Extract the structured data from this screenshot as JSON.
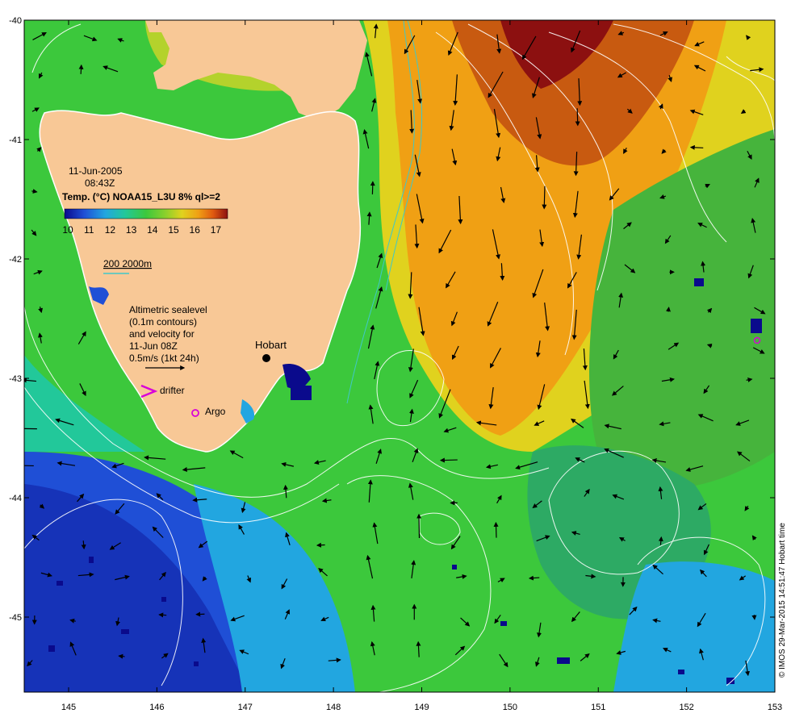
{
  "map": {
    "date": "11-Jun-2005",
    "time": "08:43Z",
    "product": "Temp. (°C) NOAA15_L3U 8% ql>=2",
    "colorbar_ticks": [
      "10",
      "11",
      "12",
      "13",
      "14",
      "15",
      "16",
      "17"
    ],
    "colorbar_colors": [
      "#0a0a8c",
      "#1f4fd6",
      "#22a6e0",
      "#22c89a",
      "#3cc83c",
      "#8cd02c",
      "#e0d21e",
      "#f0a014",
      "#e05a10",
      "#8c1010"
    ],
    "depth_contours": "200  2000m",
    "altimetry_note": [
      "Altimetric sealevel",
      "(0.1m contours)",
      "and velocity for",
      "11-Jun 08Z",
      "0.5m/s (1kt 24h)"
    ],
    "drifter_label": "drifter",
    "argo_label": "Argo",
    "city_label": "Hobart",
    "credit": "© IMOS 29-Mar-2015 14:51:47 Hobart time",
    "x_ticks": [
      "145",
      "146",
      "147",
      "148",
      "149",
      "150",
      "151",
      "152",
      "153"
    ],
    "y_ticks": [
      "-40",
      "-41",
      "-42",
      "-43",
      "-44",
      "-45"
    ],
    "colors": {
      "land": "#f8c896",
      "marker": "#d800d8",
      "contour": "#ffffff",
      "isobath": "#40c8c8"
    }
  }
}
